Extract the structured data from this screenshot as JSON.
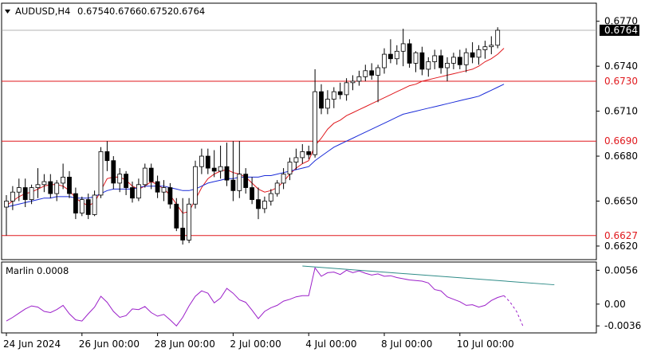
{
  "header": {
    "symbol": "AUDUSD,H4",
    "open": "0.6754",
    "high": "0.6766",
    "low": "0.6752",
    "close": "0.6764"
  },
  "colors": {
    "background": "#ffffff",
    "bull_candle": "#ffffff",
    "bear_candle": "#000000",
    "candle_outline": "#000000",
    "fast_ma": "#e0191e",
    "slow_ma": "#1a2bd8",
    "level_line": "#e0191e",
    "oscillator": "#9b1fc9",
    "trend_line": "#2e8b87",
    "current_price_bg": "#000000"
  },
  "chart_data": [
    {
      "type": "candlestick",
      "title": "AUDUSD,H4",
      "yticks": [
        "0.6770",
        "0.6740",
        "0.6710",
        "0.6680",
        "0.6650",
        "0.6620"
      ],
      "ylim": [
        0.6612,
        0.6781
      ],
      "xticks": [
        "24 Jun 2024",
        "26 Jun 00:00",
        "28 Jun 00:00",
        "2 Jul 00:00",
        "4 Jul 00:00",
        "8 Jul 00:00",
        "10 Jul 00:00"
      ],
      "current_price": "0.6764",
      "levels": [
        "0.6730",
        "0.6690",
        "0.6627"
      ],
      "candles": [
        [
          0.6646,
          0.6654,
          0.6627,
          0.665
        ],
        [
          0.665,
          0.666,
          0.6644,
          0.6656
        ],
        [
          0.6656,
          0.6665,
          0.665,
          0.6659
        ],
        [
          0.6659,
          0.6665,
          0.6646,
          0.6651
        ],
        [
          0.6651,
          0.6661,
          0.6648,
          0.6659
        ],
        [
          0.6659,
          0.6672,
          0.6652,
          0.6661
        ],
        [
          0.6661,
          0.6668,
          0.6656,
          0.6663
        ],
        [
          0.6663,
          0.6668,
          0.6652,
          0.6655
        ],
        [
          0.6655,
          0.6664,
          0.665,
          0.6662
        ],
        [
          0.6662,
          0.6675,
          0.6658,
          0.6666
        ],
        [
          0.6666,
          0.667,
          0.6652,
          0.6655
        ],
        [
          0.6655,
          0.6659,
          0.6638,
          0.6642
        ],
        [
          0.6642,
          0.6653,
          0.664,
          0.6651
        ],
        [
          0.6651,
          0.6655,
          0.6638,
          0.6641
        ],
        [
          0.6641,
          0.6657,
          0.664,
          0.6654
        ],
        [
          0.6654,
          0.6686,
          0.6652,
          0.6683
        ],
        [
          0.6683,
          0.669,
          0.667,
          0.6677
        ],
        [
          0.6677,
          0.668,
          0.6658,
          0.6662
        ],
        [
          0.6662,
          0.6672,
          0.6656,
          0.6668
        ],
        [
          0.6668,
          0.667,
          0.6654,
          0.6659
        ],
        [
          0.6659,
          0.6663,
          0.6649,
          0.6652
        ],
        [
          0.6652,
          0.6665,
          0.665,
          0.6661
        ],
        [
          0.6661,
          0.6675,
          0.6659,
          0.6672
        ],
        [
          0.6672,
          0.6675,
          0.6658,
          0.6663
        ],
        [
          0.6663,
          0.6667,
          0.6652,
          0.6656
        ],
        [
          0.6656,
          0.6664,
          0.665,
          0.6659
        ],
        [
          0.6659,
          0.6662,
          0.6645,
          0.6648
        ],
        [
          0.6648,
          0.6652,
          0.663,
          0.6632
        ],
        [
          0.6632,
          0.6652,
          0.6621,
          0.6624
        ],
        [
          0.6624,
          0.6652,
          0.6622,
          0.6648
        ],
        [
          0.6648,
          0.6677,
          0.6645,
          0.6673
        ],
        [
          0.6673,
          0.6685,
          0.6668,
          0.668
        ],
        [
          0.668,
          0.6685,
          0.6668,
          0.6672
        ],
        [
          0.6672,
          0.6684,
          0.6666,
          0.667
        ],
        [
          0.667,
          0.6687,
          0.6665,
          0.6673
        ],
        [
          0.6673,
          0.6689,
          0.666,
          0.6664
        ],
        [
          0.6664,
          0.669,
          0.665,
          0.6657
        ],
        [
          0.6657,
          0.669,
          0.6652,
          0.6668
        ],
        [
          0.6668,
          0.6672,
          0.6655,
          0.6659
        ],
        [
          0.6659,
          0.6666,
          0.6648,
          0.6651
        ],
        [
          0.6651,
          0.6659,
          0.6638,
          0.6645
        ],
        [
          0.6645,
          0.6653,
          0.6642,
          0.665
        ],
        [
          0.665,
          0.6658,
          0.6647,
          0.6655
        ],
        [
          0.6655,
          0.6664,
          0.6653,
          0.6662
        ],
        [
          0.6662,
          0.6672,
          0.6658,
          0.6668
        ],
        [
          0.6668,
          0.6679,
          0.6664,
          0.6676
        ],
        [
          0.6676,
          0.6685,
          0.6671,
          0.6679
        ],
        [
          0.6679,
          0.6688,
          0.6675,
          0.6683
        ],
        [
          0.6683,
          0.6687,
          0.6678,
          0.6681
        ],
        [
          0.6681,
          0.6738,
          0.6679,
          0.6723
        ],
        [
          0.6723,
          0.6728,
          0.6708,
          0.6712
        ],
        [
          0.6712,
          0.6724,
          0.6708,
          0.6718
        ],
        [
          0.6718,
          0.6726,
          0.6712,
          0.6723
        ],
        [
          0.6723,
          0.6729,
          0.6718,
          0.6721
        ],
        [
          0.6721,
          0.6732,
          0.6717,
          0.6729
        ],
        [
          0.6729,
          0.6734,
          0.6724,
          0.673
        ],
        [
          0.673,
          0.6737,
          0.6727,
          0.6733
        ],
        [
          0.6733,
          0.6741,
          0.673,
          0.6737
        ],
        [
          0.6737,
          0.6742,
          0.6731,
          0.6734
        ],
        [
          0.6734,
          0.6741,
          0.6716,
          0.6739
        ],
        [
          0.6739,
          0.6752,
          0.6735,
          0.6748
        ],
        [
          0.6748,
          0.6758,
          0.6742,
          0.6745
        ],
        [
          0.6745,
          0.6754,
          0.6741,
          0.675
        ],
        [
          0.675,
          0.6765,
          0.674,
          0.6755
        ],
        [
          0.6755,
          0.6758,
          0.6739,
          0.6742
        ],
        [
          0.6742,
          0.675,
          0.6736,
          0.6749
        ],
        [
          0.6749,
          0.6753,
          0.6734,
          0.6738
        ],
        [
          0.6738,
          0.6746,
          0.6733,
          0.6743
        ],
        [
          0.6743,
          0.6751,
          0.6738,
          0.6747
        ],
        [
          0.6747,
          0.6751,
          0.6735,
          0.6739
        ],
        [
          0.6739,
          0.6746,
          0.673,
          0.6742
        ],
        [
          0.6742,
          0.6749,
          0.6738,
          0.6746
        ],
        [
          0.6746,
          0.6751,
          0.6738,
          0.6741
        ],
        [
          0.6741,
          0.6752,
          0.6736,
          0.6749
        ],
        [
          0.6749,
          0.6756,
          0.6742,
          0.6746
        ],
        [
          0.6746,
          0.6754,
          0.6741,
          0.6751
        ],
        [
          0.6751,
          0.6757,
          0.6745,
          0.6753
        ],
        [
          0.6753,
          0.676,
          0.6748,
          0.6754
        ],
        [
          0.6754,
          0.6766,
          0.6752,
          0.6764
        ]
      ],
      "series": [
        {
          "values": [
            0.6647,
            0.665,
            0.6653,
            0.6655,
            0.6656,
            0.6658,
            0.666,
            0.6661,
            0.6661,
            0.666,
            0.6657,
            0.6652,
            0.6649,
            0.6647,
            0.6649,
            0.6657,
            0.6665,
            0.6666,
            0.6666,
            0.6664,
            0.666,
            0.6658,
            0.666,
            0.6663,
            0.6661,
            0.6658,
            0.6654,
            0.6648,
            0.6642,
            0.6643,
            0.6651,
            0.6659,
            0.6665,
            0.6668,
            0.667,
            0.6671,
            0.6669,
            0.6668,
            0.6666,
            0.6662,
            0.6658,
            0.6656,
            0.6657,
            0.6659,
            0.6663,
            0.6668,
            0.6672,
            0.6675,
            0.6677,
            0.6687,
            0.6692,
            0.6698,
            0.6702,
            0.6704,
            0.6707,
            0.6709,
            0.6711,
            0.6713,
            0.6715,
            0.6717,
            0.6719,
            0.6721,
            0.6723,
            0.6725,
            0.6727,
            0.6728,
            0.673,
            0.6731,
            0.6732,
            0.6733,
            0.6734,
            0.6735,
            0.6736,
            0.6737,
            0.6738,
            0.674,
            0.6743,
            0.6745,
            0.6748,
            0.6752
          ]
        },
        {
          "values": [
            0.6646,
            0.6647,
            0.6648,
            0.6649,
            0.665,
            0.6651,
            0.6652,
            0.6652,
            0.6653,
            0.6653,
            0.6653,
            0.6652,
            0.6652,
            0.6652,
            0.6653,
            0.6655,
            0.6657,
            0.6658,
            0.6658,
            0.6658,
            0.6658,
            0.6659,
            0.666,
            0.666,
            0.666,
            0.666,
            0.6659,
            0.6658,
            0.6657,
            0.6657,
            0.6658,
            0.666,
            0.6662,
            0.6663,
            0.6664,
            0.6665,
            0.6665,
            0.6666,
            0.6666,
            0.6666,
            0.6666,
            0.6667,
            0.6667,
            0.6668,
            0.6669,
            0.667,
            0.6671,
            0.6672,
            0.6673,
            0.6677,
            0.668,
            0.6683,
            0.6686,
            0.6688,
            0.669,
            0.6692,
            0.6694,
            0.6696,
            0.6698,
            0.67,
            0.6702,
            0.6704,
            0.6706,
            0.6708,
            0.6709,
            0.671,
            0.6711,
            0.6712,
            0.6713,
            0.6714,
            0.6715,
            0.6716,
            0.6717,
            0.6718,
            0.6719,
            0.672,
            0.6722,
            0.6724,
            0.6726,
            0.6728
          ]
        }
      ]
    },
    {
      "type": "line",
      "title": "Marlin 0.0008",
      "yticks": [
        "0.0056",
        "0.00",
        "-0.0036"
      ],
      "ylim": [
        -0.0045,
        0.0067
      ],
      "values": [
        -0.0028,
        -0.0022,
        -0.0015,
        -0.0008,
        -0.0003,
        -0.0005,
        -0.0012,
        -0.0014,
        -0.0009,
        -0.0002,
        -0.0016,
        -0.0026,
        -0.0028,
        -0.0016,
        -0.0005,
        0.0013,
        0.0003,
        -0.0012,
        -0.0022,
        -0.0019,
        -0.0008,
        -0.0009,
        -0.0004,
        -0.0014,
        -0.002,
        -0.0017,
        -0.0026,
        -0.0036,
        -0.0022,
        -0.0003,
        0.0013,
        0.0022,
        0.0018,
        0.0002,
        0.001,
        0.0026,
        0.0018,
        0.0007,
        0.0003,
        -0.001,
        -0.0024,
        -0.0012,
        -0.0006,
        -0.0002,
        0.0005,
        0.0008,
        0.0012,
        0.0014,
        0.0014,
        0.006,
        0.0046,
        0.0052,
        0.0053,
        0.0049,
        0.0056,
        0.0052,
        0.0055,
        0.0051,
        0.0048,
        0.005,
        0.0046,
        0.0047,
        0.0044,
        0.0042,
        0.004,
        0.0039,
        0.0038,
        0.0035,
        0.0024,
        0.0022,
        0.0012,
        0.0008,
        0.0004,
        -0.0002,
        -0.0001,
        -0.0005,
        -0.0002,
        0.0006,
        0.0011,
        0.0014
      ],
      "forecast": [
        0.0014,
        0.0003,
        -0.0012,
        -0.0036
      ],
      "trend_line": [
        0.0063,
        0.0032
      ]
    }
  ]
}
